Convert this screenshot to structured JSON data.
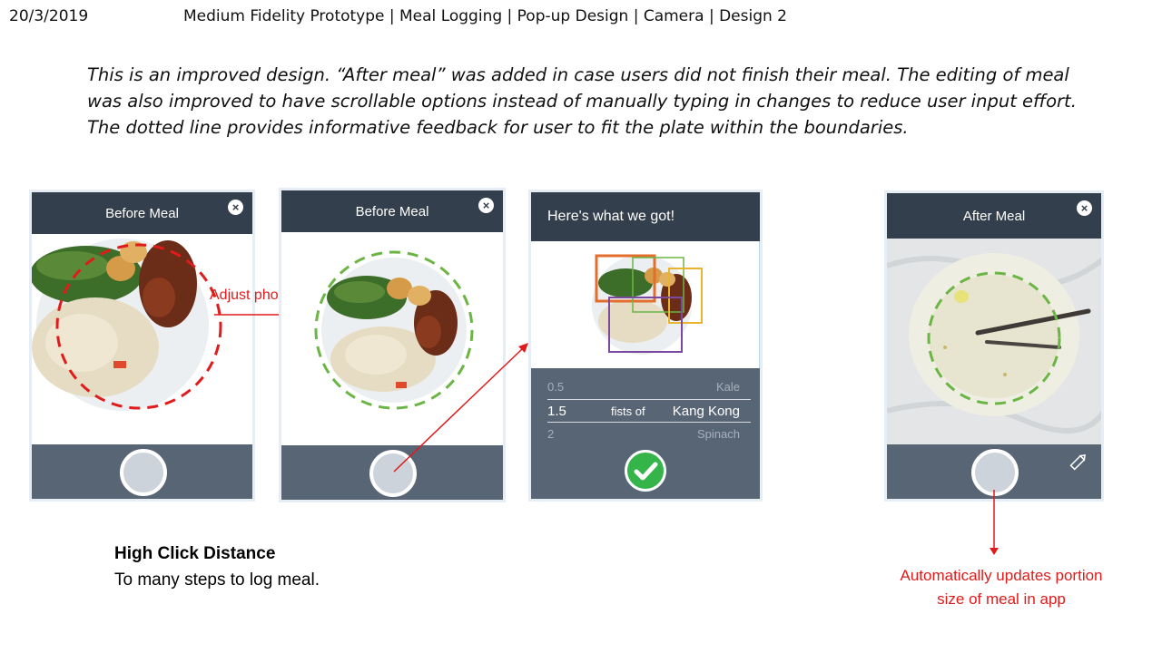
{
  "header": {
    "date": "20/3/2019",
    "title": "Medium Fidelity Prototype | Meal Logging | Pop-up Design | Camera | Design 2"
  },
  "description": "This is an improved design. “After meal” was added in case users did not finish their meal. The editing of meal was also improved to have scrollable options instead of manually typing in changes to reduce user input effort. The dotted line provides informative feedback for user to fit the plate within the boundaries.",
  "screens": {
    "s1": {
      "title": "Before Meal",
      "close_icon": "×"
    },
    "s2": {
      "title": "Before Meal",
      "close_icon": "×"
    },
    "s3": {
      "title": "Here's what we got!",
      "picker": {
        "unit": "fists of",
        "rows": [
          {
            "qty": "0.5",
            "food": "Kale"
          },
          {
            "qty": "1.5",
            "food": "Kang Kong"
          },
          {
            "qty": "2",
            "food": "Spinach"
          }
        ]
      },
      "confirm_icon": "checkmark-icon"
    },
    "s4": {
      "title": "After Meal",
      "close_icon": "×",
      "edit_icon": "pencil-icon"
    }
  },
  "annotations": {
    "adjust": "Adjust phone",
    "click_title": "High Click Distance",
    "click_text": "To many steps to log meal.",
    "auto_line1": "Automatically updates portion",
    "auto_line2": "size of meal in app"
  },
  "colors": {
    "header_bar": "#333f4c",
    "footer_bar": "#586575",
    "annotation_red": "#e01b1b",
    "guide_green": "#6bb545",
    "confirm_green": "#35b449"
  }
}
